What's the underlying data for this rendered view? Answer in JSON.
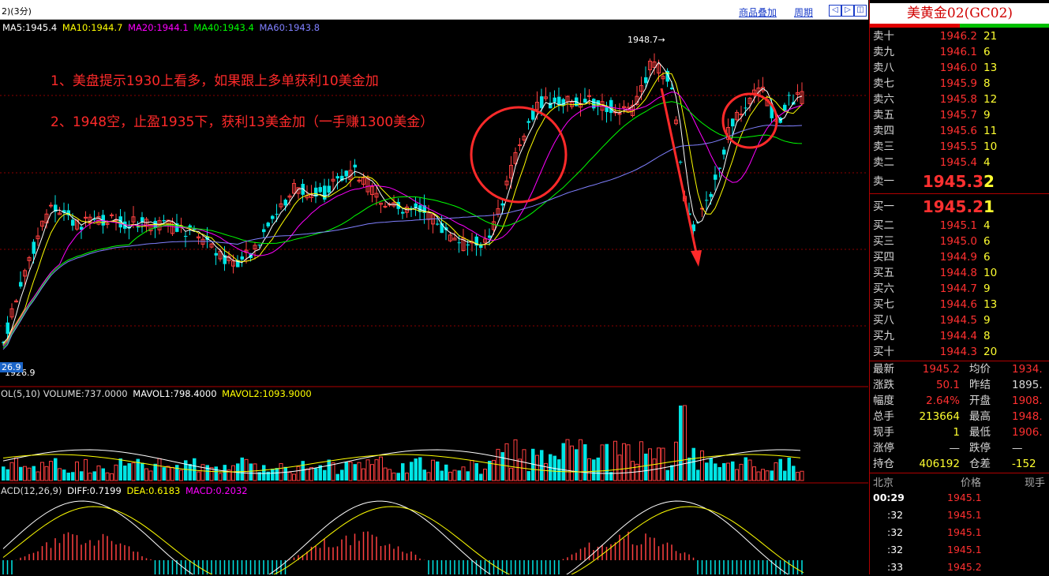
{
  "toolbar": {
    "period": "2)(3分)",
    "overlay_label": "商品叠加",
    "cycle_label": "周期",
    "nav_left": "◁",
    "nav_right": "▷",
    "nav_zoom": "◫"
  },
  "ma_legend": [
    {
      "text": "MA5:1945.4",
      "color": "#ffffff"
    },
    {
      "text": "MA10:1944.7",
      "color": "#ffff00"
    },
    {
      "text": "MA20:1944.1",
      "color": "#ff00ff"
    },
    {
      "text": "MA40:1943.4",
      "color": "#00ff00"
    },
    {
      "text": "MA60:1943.8",
      "color": "#8080ff"
    }
  ],
  "annotations": {
    "line1": "1、美盘提示1930上看多，如果跟上多单获利10美金加",
    "line2": "2、1948空，止盈1935下，获利13美金加（一手赚1300美金）",
    "high_marker": "1948.7→",
    "low_marker": "1926.9",
    "low_box": "26.9"
  },
  "volume_legend": {
    "name": "OL(5,10)",
    "volume": "VOLUME:737.0000",
    "mavol1": "MAVOL1:798.4000",
    "mavol2": "MAVOL2:1093.9000"
  },
  "macd_legend": {
    "name": "ACD(12,26,9)",
    "diff": "DIFF:0.7199",
    "dea": "DEA:0.6183",
    "macd": "MACD:0.2032"
  },
  "panel": {
    "title": "美黄金02(GC02)",
    "asks": [
      {
        "label": "卖十",
        "price": "1946.2",
        "vol": "21"
      },
      {
        "label": "卖九",
        "price": "1946.1",
        "vol": "6"
      },
      {
        "label": "卖八",
        "price": "1946.0",
        "vol": "13"
      },
      {
        "label": "卖七",
        "price": "1945.9",
        "vol": "8"
      },
      {
        "label": "卖六",
        "price": "1945.8",
        "vol": "12"
      },
      {
        "label": "卖五",
        "price": "1945.7",
        "vol": "9"
      },
      {
        "label": "卖四",
        "price": "1945.6",
        "vol": "11"
      },
      {
        "label": "卖三",
        "price": "1945.5",
        "vol": "10"
      },
      {
        "label": "卖二",
        "price": "1945.4",
        "vol": "4"
      },
      {
        "label": "卖一",
        "price": "1945.3",
        "vol": "2"
      }
    ],
    "bids": [
      {
        "label": "买一",
        "price": "1945.2",
        "vol": "1"
      },
      {
        "label": "买二",
        "price": "1945.1",
        "vol": "4"
      },
      {
        "label": "买三",
        "price": "1945.0",
        "vol": "6"
      },
      {
        "label": "买四",
        "price": "1944.9",
        "vol": "6"
      },
      {
        "label": "买五",
        "price": "1944.8",
        "vol": "10"
      },
      {
        "label": "买六",
        "price": "1944.7",
        "vol": "9"
      },
      {
        "label": "买七",
        "price": "1944.6",
        "vol": "13"
      },
      {
        "label": "买八",
        "price": "1944.5",
        "vol": "9"
      },
      {
        "label": "买九",
        "price": "1944.4",
        "vol": "8"
      },
      {
        "label": "买十",
        "price": "1944.3",
        "vol": "20"
      }
    ],
    "stats": [
      {
        "l1": "最新",
        "v1": "1945.2",
        "l2": "均价",
        "v2": "1934."
      },
      {
        "l1": "涨跌",
        "v1": "50.1",
        "l2": "昨结",
        "v2": "1895."
      },
      {
        "l1": "幅度",
        "v1": "2.64%",
        "l2": "开盘",
        "v2": "1908."
      },
      {
        "l1": "总手",
        "v1": "213664",
        "l2": "最高",
        "v2": "1948."
      },
      {
        "l1": "现手",
        "v1": "1",
        "l2": "最低",
        "v2": "1906."
      },
      {
        "l1": "涨停",
        "v1": "—",
        "l2": "跌停",
        "v2": "—"
      },
      {
        "l1": "持仓",
        "v1": "406192",
        "l2": "仓差",
        "v2": "-152"
      }
    ],
    "ticks_header": {
      "time": "北京",
      "price": "价格",
      "vol": "现手"
    },
    "ticks": [
      {
        "time": "00:29",
        "price": "1945.1"
      },
      {
        "time": ":32",
        "price": "1945.1"
      },
      {
        "time": ":32",
        "price": "1945.1"
      },
      {
        "time": ":32",
        "price": "1945.1"
      },
      {
        "time": ":33",
        "price": "1945.2"
      }
    ]
  },
  "colors": {
    "up": "#ff4040",
    "down": "#00e5e5",
    "grid": "#8b0000",
    "ma5": "#ffffff",
    "ma10": "#ffff00",
    "ma20": "#ff00ff",
    "ma40": "#00ff00",
    "ma60": "#8080ff",
    "annotation": "#ff2a2a"
  }
}
